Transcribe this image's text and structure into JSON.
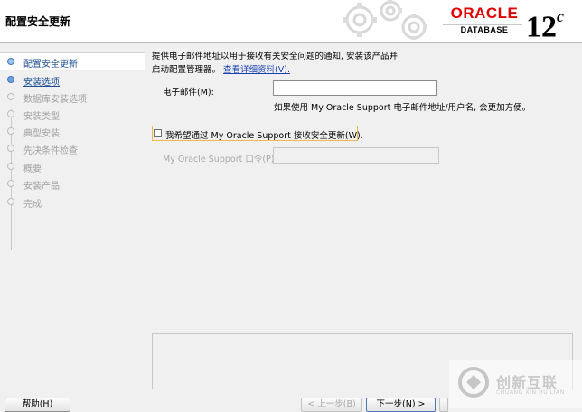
{
  "header": {
    "title": "配置安全更新",
    "brand": "ORACLE",
    "product": "DATABASE",
    "version_number": "12",
    "version_suffix": "c"
  },
  "sidebar": {
    "steps": [
      {
        "label": "配置安全更新",
        "state": "active"
      },
      {
        "label": "安装选项",
        "state": "link"
      },
      {
        "label": "数据库安装选项",
        "state": "disabled"
      },
      {
        "label": "安装类型",
        "state": "disabled"
      },
      {
        "label": "典型安装",
        "state": "disabled"
      },
      {
        "label": "先决条件检查",
        "state": "disabled"
      },
      {
        "label": "概要",
        "state": "disabled"
      },
      {
        "label": "安装产品",
        "state": "disabled"
      },
      {
        "label": "完成",
        "state": "disabled"
      }
    ]
  },
  "main": {
    "intro_line1": "提供电子邮件地址以用于接收有关安全问题的通知, 安装该产品并",
    "intro_line2": "启动配置管理器。",
    "details_link": "查看详细资料(V).",
    "email_label": "电子邮件(M):",
    "email_value": "",
    "email_hint": "如果使用 My Oracle Support 电子邮件地址/用户名, 会更加方便。",
    "security_checkbox_label": "我希望通过 My Oracle Support 接收安全更新(W).",
    "security_checkbox_checked": false,
    "password_label": "My Oracle Support 口令(P):",
    "password_value": ""
  },
  "footer": {
    "help_button": "帮助(H)",
    "back_button": "< 上一步(B)",
    "next_button": "下一步(N) >"
  },
  "watermark": {
    "cn": "创新互联",
    "en": "CHUANG XIN HU LIAN"
  },
  "colors": {
    "oracle_red": "#e00000",
    "link_blue": "#1a3fb0",
    "focus_orange": "#f0b84c"
  }
}
